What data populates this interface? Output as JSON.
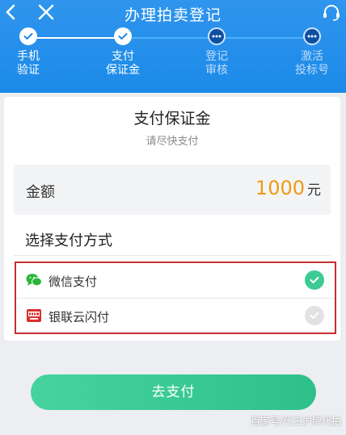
{
  "nav": {
    "title": "办理拍卖登记"
  },
  "steps": [
    {
      "line1": "手机",
      "line2": "验证",
      "status": "done"
    },
    {
      "line1": "支付",
      "line2": "保证金",
      "status": "done"
    },
    {
      "line1": "登记",
      "line2": "审核",
      "status": "pending"
    },
    {
      "line1": "激活",
      "line2": "投标号",
      "status": "pending"
    }
  ],
  "card": {
    "title": "支付保证金",
    "subtitle": "请尽快支付",
    "amount_label": "金额",
    "amount_value": "1000",
    "amount_unit": "元",
    "method_title": "选择支付方式",
    "methods": [
      {
        "name": "微信支付",
        "icon": "wechat-icon",
        "selected": true
      },
      {
        "name": "银联云闪付",
        "icon": "unionpay-icon",
        "selected": false
      }
    ]
  },
  "pay_button": "去支付",
  "watermark": "百家号/代王沪牌代拍",
  "colors": {
    "header": "#2f95ee",
    "accent": "#f09a13",
    "button": "#3ecb93",
    "highlight_border": "#c23030"
  }
}
